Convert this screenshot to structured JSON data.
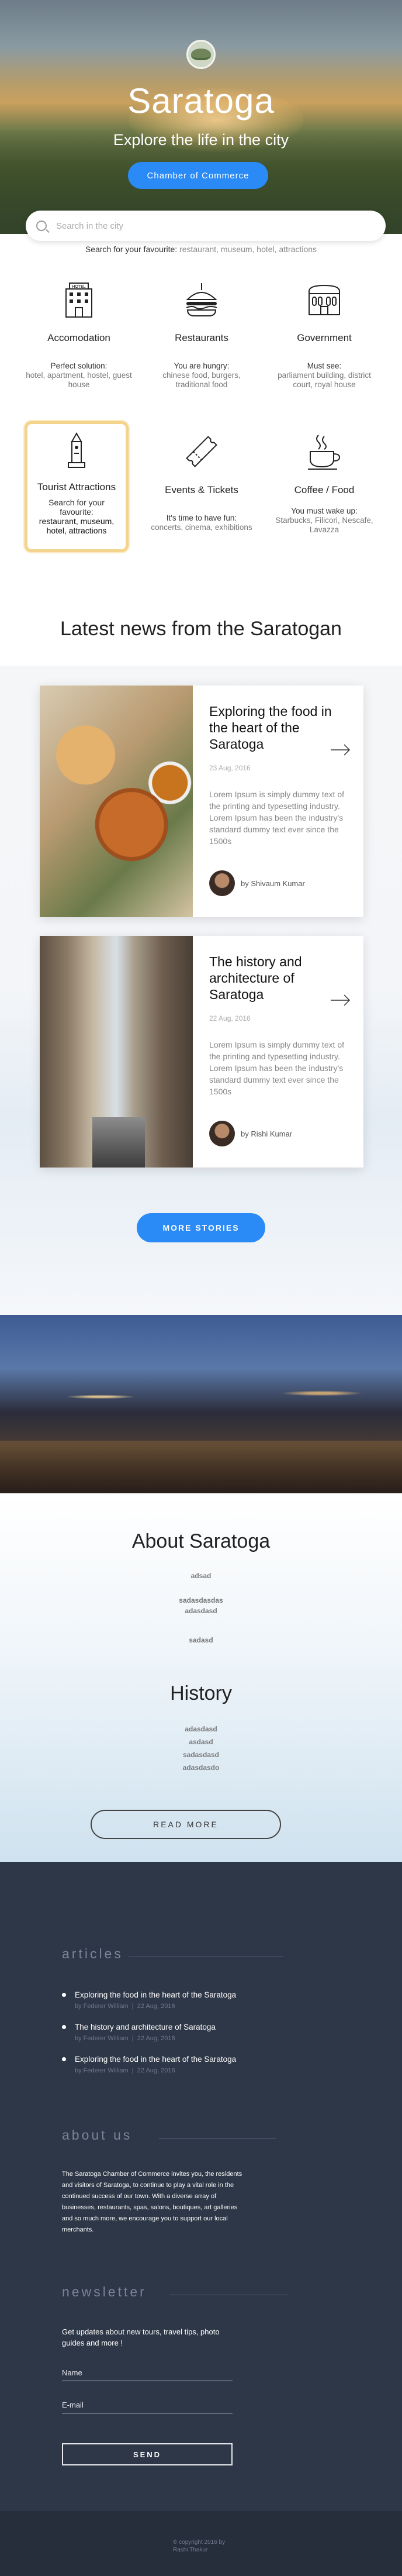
{
  "hero": {
    "title": "Saratoga",
    "subtitle": "Explore the life in the city",
    "cta_label": "Chamber of Commerce"
  },
  "search": {
    "placeholder": "Search in the city",
    "favourite_prefix": "Search for your favourite:",
    "favourite_terms": "restaurant, museum, hotel, attractions"
  },
  "categories": [
    {
      "title": "Accomodation",
      "desc_dark": "Perfect solution:",
      "desc": "hotel, apartment, hostel, guest house",
      "icon": "hotel-icon"
    },
    {
      "title": "Restaurants",
      "desc_dark": "You are hungry:",
      "desc": "chinese food, burgers, traditional food",
      "icon": "burger-icon"
    },
    {
      "title": "Government",
      "desc_dark": "Must see:",
      "desc": "parliament building, district court, royal house",
      "icon": "government-building-icon"
    },
    {
      "title": "Tourist Attractions",
      "desc_dark": "Search for your favourite:",
      "desc": "restaurant, museum, hotel, attractions",
      "icon": "monument-icon"
    },
    {
      "title": "Events & Tickets",
      "desc_dark": "It's time to have fun:",
      "desc": "concerts, cinema, exhibitions",
      "icon": "ticket-icon"
    },
    {
      "title": "Coffee / Food",
      "desc_dark": "You must wake up:",
      "desc": "Starbucks, Filicori, Nescafe, Lavazza",
      "icon": "coffee-cup-icon"
    }
  ],
  "news": {
    "heading": "Latest news from the Saratogan",
    "articles": [
      {
        "title": "Exploring the food in the heart of the Saratoga",
        "date": "23 Aug, 2016",
        "body": "Lorem Ipsum is simply dummy text of the printing and typesetting industry. Lorem Ipsum has been the industry's standard dummy text ever since the 1500s",
        "author": "by Shivaum Kumar"
      },
      {
        "title": "The history and architecture of Saratoga",
        "date": "22 Aug, 2016",
        "body": "Lorem Ipsum is simply dummy text of the printing and typesetting industry. Lorem Ipsum has been the industry's standard dummy text ever since the 1500s",
        "author": "by Rishi  Kumar"
      }
    ],
    "more_label": "MORE STORIES"
  },
  "about": {
    "heading": "About Saratoga",
    "lines": [
      "adsad",
      "sadasdasdas",
      "adasdasd",
      "sadasd"
    ]
  },
  "history": {
    "heading": "History",
    "lines": [
      "adasdasd",
      "asdasd",
      "sadasdasd",
      "adasdasdo"
    ],
    "read_more_label": "READ MORE"
  },
  "footer": {
    "articles_heading": "articles",
    "articles": [
      {
        "title": "Exploring the food in the heart of the Saratoga",
        "author": "by Federer William",
        "date": "22 Aug, 2016"
      },
      {
        "title": "The history and architecture of Saratoga",
        "author": "by Federer William",
        "date": "22 Aug, 2016"
      },
      {
        "title": "Exploring the food in the heart of the Saratoga",
        "author": "by Federer William",
        "date": "22 Aug, 2016"
      }
    ],
    "about_heading": "about us",
    "about_text": "The Saratoga Chamber of Commerce invites you, the residents and visitors of Saratoga, to continue to play a vital role in the continued success of our town. With a diverse array of businesses, restaurants, spas, salons, boutiques, art galleries and so much more, we encourage you to support our local merchants.",
    "newsletter_heading": "newsletter",
    "newsletter_text": "Get updates about new tours, travel tips, photo guides and more !",
    "name_placeholder": "Name",
    "email_placeholder": "E-mail",
    "send_label": "SEND",
    "copyright": "© copyright 2016 by Rashi Thakur"
  },
  "colors": {
    "accent": "#2a8af6",
    "footer_bg": "#2e3747",
    "highlight_border": "#f4d48d"
  }
}
